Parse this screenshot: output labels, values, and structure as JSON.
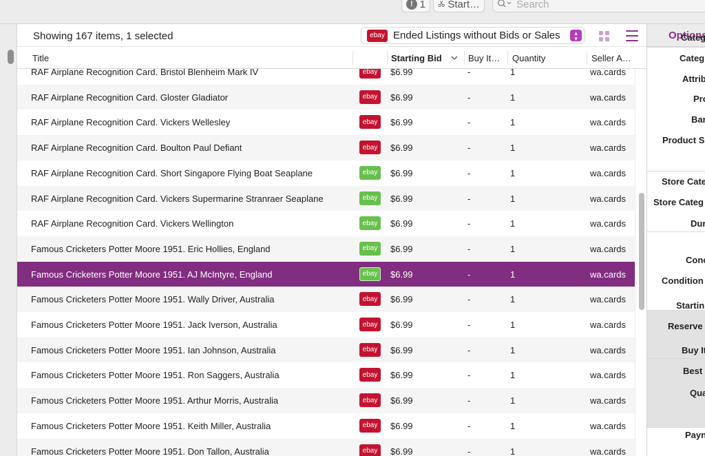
{
  "toolbar": {
    "count_label": "1",
    "start_label": "Start…",
    "search_placeholder": "Search"
  },
  "header": {
    "showing_text": "Showing 167 items, 1 selected",
    "listing_filter_tag": "ebay",
    "listing_filter_value": "Ended Listings without Bids or Sales"
  },
  "columns": {
    "title": "Title",
    "starting_bid": "Starting Bid",
    "buy_it_now": "Buy It…",
    "quantity": "Quantity",
    "seller": "Seller A…"
  },
  "colors": {
    "accent": "#812d80",
    "ebay_red": "#c41230",
    "ebay_green": "#67c04d"
  },
  "rows": [
    {
      "title": "RAF Airplane Recognition Card. Bristol Blenheim Mark IV",
      "tag": "ebay",
      "tag_color": "red",
      "bid": "$6.99",
      "buy": "-",
      "qty": "1",
      "seller": "wa.cards",
      "selected": false
    },
    {
      "title": "RAF Airplane Recognition Card. Gloster Gladiator",
      "tag": "ebay",
      "tag_color": "red",
      "bid": "$6.99",
      "buy": "-",
      "qty": "1",
      "seller": "wa.cards",
      "selected": false
    },
    {
      "title": "RAF Airplane Recognition Card. Vickers Wellesley",
      "tag": "ebay",
      "tag_color": "red",
      "bid": "$6.99",
      "buy": "-",
      "qty": "1",
      "seller": "wa.cards",
      "selected": false
    },
    {
      "title": "RAF Airplane Recognition Card. Boulton Paul Defiant",
      "tag": "ebay",
      "tag_color": "red",
      "bid": "$6.99",
      "buy": "-",
      "qty": "1",
      "seller": "wa.cards",
      "selected": false
    },
    {
      "title": "RAF Airplane Recognition Card. Short Singapore Flying Boat Seaplane",
      "tag": "ebay",
      "tag_color": "green",
      "bid": "$6.99",
      "buy": "-",
      "qty": "1",
      "seller": "wa.cards",
      "selected": false
    },
    {
      "title": "RAF Airplane Recognition Card. Vickers Supermarine Stranraer Seaplane",
      "tag": "ebay",
      "tag_color": "green",
      "bid": "$6.99",
      "buy": "-",
      "qty": "1",
      "seller": "wa.cards",
      "selected": false
    },
    {
      "title": "RAF Airplane Recognition Card. Vickers Wellington",
      "tag": "ebay",
      "tag_color": "green",
      "bid": "$6.99",
      "buy": "-",
      "qty": "1",
      "seller": "wa.cards",
      "selected": false
    },
    {
      "title": "Famous Cricketers Potter Moore 1951. Eric Hollies, England",
      "tag": "ebay",
      "tag_color": "green",
      "bid": "$6.99",
      "buy": "-",
      "qty": "1",
      "seller": "wa.cards",
      "selected": false
    },
    {
      "title": "Famous Cricketers Potter Moore 1951. AJ McIntyre, England",
      "tag": "ebay",
      "tag_color": "green",
      "bid": "$6.99",
      "buy": "-",
      "qty": "1",
      "seller": "wa.cards",
      "selected": true
    },
    {
      "title": "Famous Cricketers Potter Moore 1951. Wally Driver, Australia",
      "tag": "ebay",
      "tag_color": "red",
      "bid": "$6.99",
      "buy": "-",
      "qty": "1",
      "seller": "wa.cards",
      "selected": false
    },
    {
      "title": "Famous Cricketers Potter Moore 1951. Jack Iverson, Australia",
      "tag": "ebay",
      "tag_color": "red",
      "bid": "$6.99",
      "buy": "-",
      "qty": "1",
      "seller": "wa.cards",
      "selected": false
    },
    {
      "title": "Famous Cricketers Potter Moore 1951. Ian Johnson, Australia",
      "tag": "ebay",
      "tag_color": "red",
      "bid": "$6.99",
      "buy": "-",
      "qty": "1",
      "seller": "wa.cards",
      "selected": false
    },
    {
      "title": "Famous Cricketers Potter Moore 1951. Ron Saggers, Australia",
      "tag": "ebay",
      "tag_color": "red",
      "bid": "$6.99",
      "buy": "-",
      "qty": "1",
      "seller": "wa.cards",
      "selected": false
    },
    {
      "title": "Famous Cricketers Potter Moore 1951. Arthur Morris, Australia",
      "tag": "ebay",
      "tag_color": "red",
      "bid": "$6.99",
      "buy": "-",
      "qty": "1",
      "seller": "wa.cards",
      "selected": false
    },
    {
      "title": "Famous Cricketers Potter Moore 1951. Keith Miller, Australia",
      "tag": "ebay",
      "tag_color": "red",
      "bid": "$6.99",
      "buy": "-",
      "qty": "1",
      "seller": "wa.cards",
      "selected": false
    },
    {
      "title": "Famous Cricketers Potter Moore 1951. Don Tallon, Australia",
      "tag": "ebay",
      "tag_color": "red",
      "bid": "$6.99",
      "buy": "-",
      "qty": "1",
      "seller": "wa.cards",
      "selected": false
    }
  ],
  "options_panel": {
    "title": "Options",
    "fields": [
      "Categ",
      "Categ",
      "Attrib",
      "Pro",
      "Bar",
      "Product S",
      "Store Cate",
      "Store Categ",
      "Dur",
      "Conc",
      "Condition",
      "Startin",
      "Reserve",
      "Buy It",
      "Best",
      "Qua",
      "Payn"
    ]
  }
}
